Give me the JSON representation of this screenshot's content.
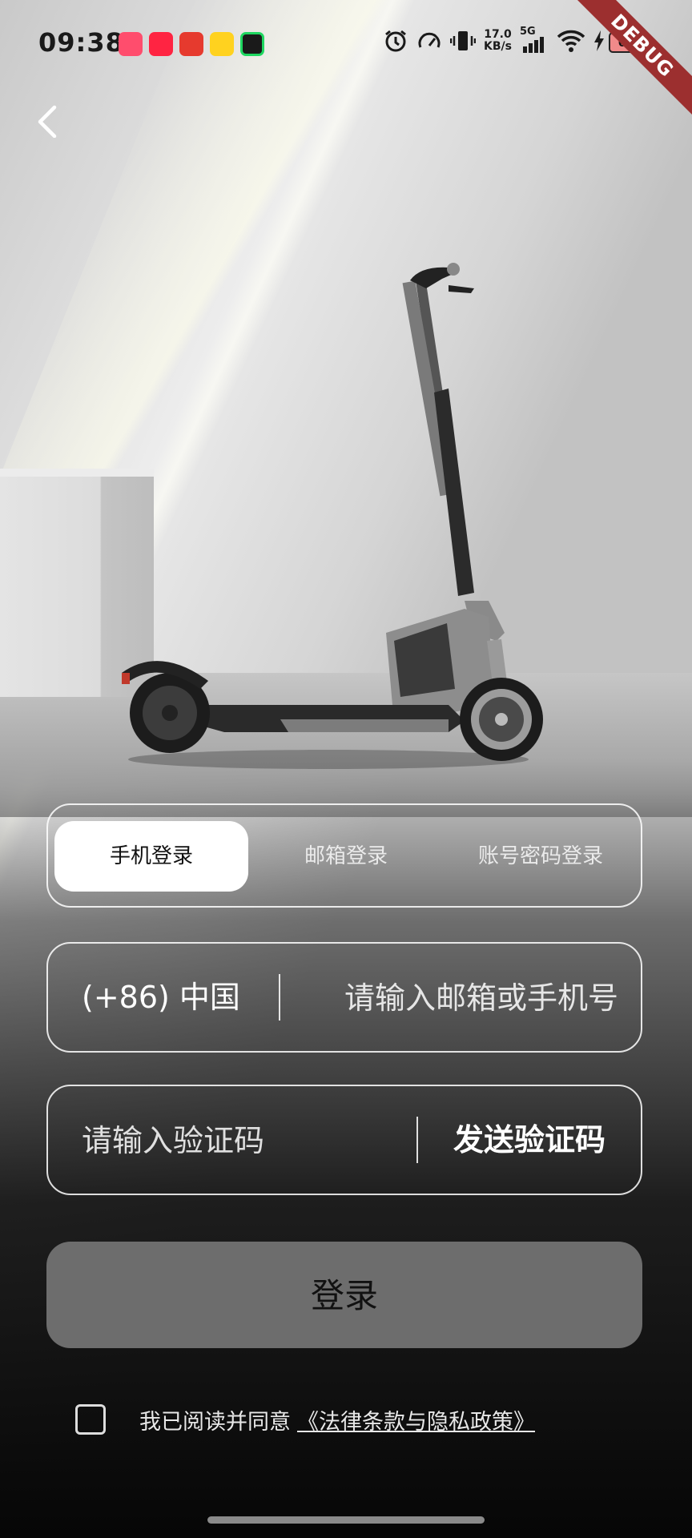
{
  "status_bar": {
    "time": "09:38",
    "app_icons": [
      {
        "name": "video-app-icon",
        "color": "#ff4d6d"
      },
      {
        "name": "xiaohongshu-app-icon",
        "color": "#ff2442"
      },
      {
        "name": "netease-music-app-icon",
        "color": "#e63a2e"
      },
      {
        "name": "photo-app-icon",
        "color": "#ffd21f"
      },
      {
        "name": "music-app-icon",
        "color": "#1ed760"
      }
    ],
    "net_speed_value": "17.0",
    "net_speed_unit": "KB/s",
    "network": "5G",
    "battery": "68",
    "debug_banner": "DEBUG"
  },
  "tabs": [
    {
      "label": "手机登录",
      "active": true
    },
    {
      "label": "邮箱登录",
      "active": false
    },
    {
      "label": "账号密码登录",
      "active": false
    }
  ],
  "phone_field": {
    "country": "(+86) 中国",
    "placeholder": "请输入邮箱或手机号",
    "value": ""
  },
  "code_field": {
    "placeholder": "请输入验证码",
    "value": "",
    "send_label": "发送验证码"
  },
  "login_button": "登录",
  "agreement": {
    "checked": false,
    "text": "我已阅读并同意",
    "link": "《法律条款与隐私政策》"
  },
  "colors": {
    "accent_white": "#ffffff",
    "button_gray": "#6d6d6d",
    "debug_red": "#9c2f2f"
  }
}
